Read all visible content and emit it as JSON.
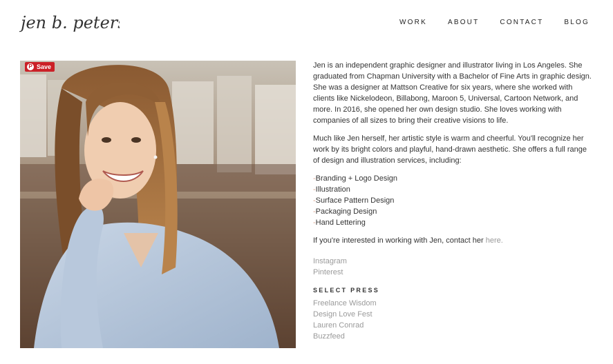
{
  "brand": {
    "logo_text": "jen b. peters"
  },
  "nav": {
    "items": [
      "WORK",
      "ABOUT",
      "CONTACT",
      "BLOG"
    ]
  },
  "photo": {
    "save_label": "Save",
    "pin_glyph": "P"
  },
  "bio": {
    "paragraph1": "Jen is an independent graphic designer and illustrator living in Los Angeles. She graduated from Chapman University with a Bachelor of Fine Arts in graphic design. She was a designer at Mattson Creative for six years, where she worked with clients like Nickelodeon, Billabong, Maroon 5, Universal, Cartoon Network, and more. In 2016, she opened her own design studio. She loves working with companies of all sizes to bring their creative visions to life.",
    "paragraph2": "Much like Jen herself, her artistic style is warm and cheerful. You'll recognize her work by its bright colors and playful, hand-drawn aesthetic. She offers a full range of design and illustration services, including:",
    "services_dash": "-",
    "services": [
      "Branding + Logo Design",
      "Illustration",
      "Surface Pattern Design",
      "Packaging Design",
      "Hand Lettering"
    ],
    "contact_text": "If you're interested in working with Jen, contact her ",
    "contact_link": "here."
  },
  "social": {
    "links": [
      "Instagram",
      "Pinterest"
    ]
  },
  "press": {
    "heading": "SELECT PRESS",
    "links": [
      "Freelance Wisdom",
      "Design Love Fest",
      "Lauren Conrad",
      "Buzzfeed"
    ]
  }
}
